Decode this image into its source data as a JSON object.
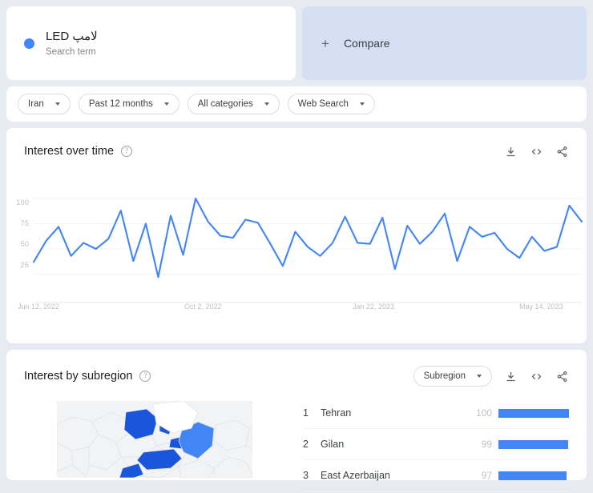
{
  "search": {
    "term": "لامپ LED",
    "subtitle": "Search term",
    "dot_color": "#4285f4"
  },
  "compare": {
    "plus": "+",
    "label": "Compare"
  },
  "filters": [
    {
      "label": "Iran",
      "name": "region-filter"
    },
    {
      "label": "Past 12 months",
      "name": "time-filter"
    },
    {
      "label": "All categories",
      "name": "category-filter"
    },
    {
      "label": "Web Search",
      "name": "search-type-filter"
    }
  ],
  "interest_over_time": {
    "title": "Interest over time",
    "help": "?",
    "actions": [
      "download-icon",
      "embed-icon",
      "share-icon"
    ]
  },
  "interest_by_subregion": {
    "title": "Interest by subregion",
    "help": "?",
    "dropdown": "Subregion",
    "actions": [
      "download-icon",
      "embed-icon",
      "share-icon"
    ],
    "rows": [
      {
        "rank": "1",
        "name": "Tehran",
        "value": "100"
      },
      {
        "rank": "2",
        "name": "Gilan",
        "value": "99"
      },
      {
        "rank": "3",
        "name": "East Azerbaijan",
        "value": "97"
      }
    ]
  },
  "chart_data": {
    "type": "line",
    "title": "Interest over time",
    "xlabel": "",
    "ylabel": "",
    "ylim": [
      0,
      100
    ],
    "yticks": [
      25,
      50,
      75,
      100
    ],
    "xticks": [
      "Jun 12, 2022",
      "Oct 2, 2022",
      "Jan 22, 2023",
      "May 14, 2023"
    ],
    "grid": true,
    "legend_position": "none",
    "line_color": "#4285f4",
    "series": [
      {
        "name": "لامپ LED",
        "values": [
          37,
          58,
          72,
          43,
          56,
          50,
          60,
          88,
          38,
          75,
          22,
          83,
          44,
          100,
          77,
          63,
          61,
          79,
          76,
          55,
          33,
          67,
          52,
          43,
          56,
          82,
          56,
          55,
          81,
          30,
          73,
          55,
          67,
          85,
          38,
          72,
          62,
          66,
          50,
          41,
          62,
          48,
          52,
          93,
          77
        ]
      }
    ]
  },
  "map": {
    "background": "#f1f3f4",
    "region_colors": [
      "#1a56db",
      "#1a56db",
      "#4285f4",
      "#ffffff"
    ]
  }
}
